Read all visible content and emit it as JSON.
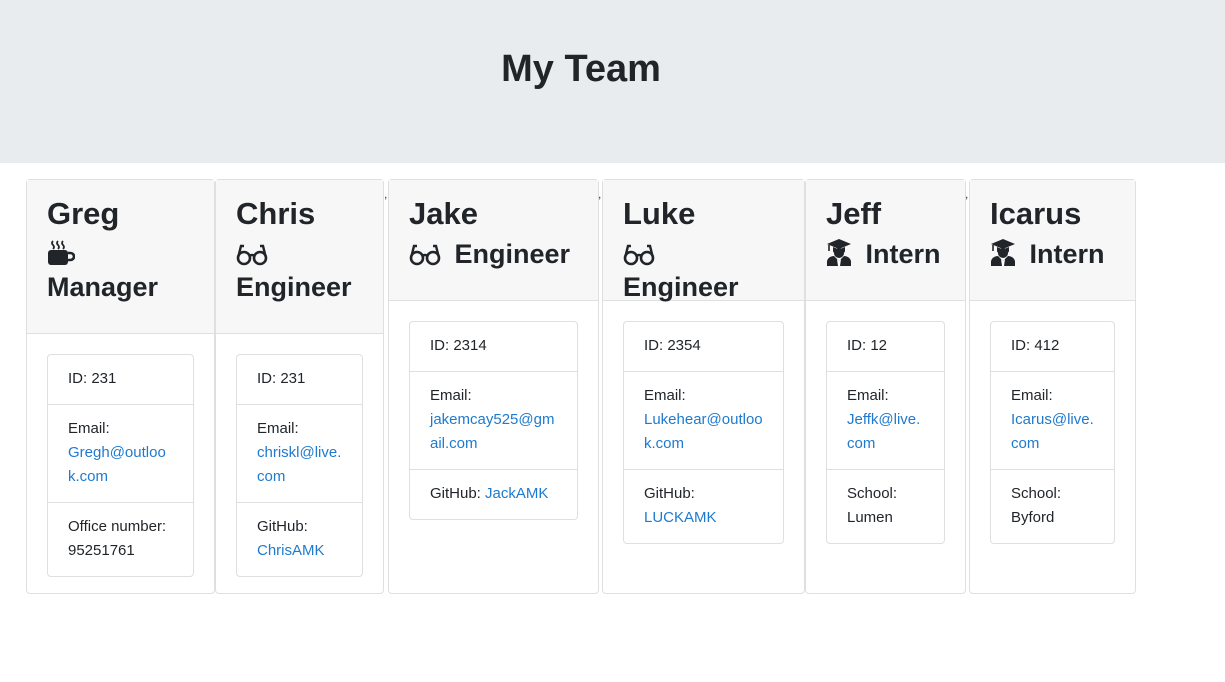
{
  "page": {
    "title": "My Team"
  },
  "icons": {
    "manager": "coffee-icon",
    "engineer": "glasses-icon",
    "intern": "graduate-icon"
  },
  "colors": {
    "header_bg": "#e9ecef",
    "link": "#1f7acf"
  },
  "separator": ",",
  "cards": [
    {
      "name": "Greg",
      "role": "Manager",
      "id_text": "ID: 231",
      "email_label": "Email:",
      "email": "Gregh@outlook.com",
      "extra_label": "Office number:",
      "extra_value": "95251761"
    },
    {
      "name": "Chris",
      "role": "Engineer",
      "id_text": "ID: 231",
      "email_label": "Email:",
      "email": "chriskl@live.com",
      "extra_label": "GitHub:",
      "extra_value": "ChrisAMK"
    },
    {
      "name": "Jake",
      "role": "Engineer",
      "id_text": "ID: 2314",
      "email_label": "Email:",
      "email": "jakemcay525@gmail.com",
      "extra_label": "GitHub:",
      "extra_value": "JackAMK"
    },
    {
      "name": "Luke",
      "role": "Engineer",
      "id_text": "ID: 2354",
      "email_label": "Email:",
      "email": "Lukehear@outlook.com",
      "extra_label": "GitHub:",
      "extra_value": "LUCKAMK"
    },
    {
      "name": "Jeff",
      "role": "Intern",
      "id_text": "ID: 12",
      "email_label": "Email:",
      "email": "Jeffk@live.com",
      "extra_label": "School:",
      "extra_value": "Lumen"
    },
    {
      "name": "Icarus",
      "role": "Intern",
      "id_text": "ID: 412",
      "email_label": "Email:",
      "email": "Icarus@live.com",
      "extra_label": "School:",
      "extra_value": "Byford"
    }
  ]
}
